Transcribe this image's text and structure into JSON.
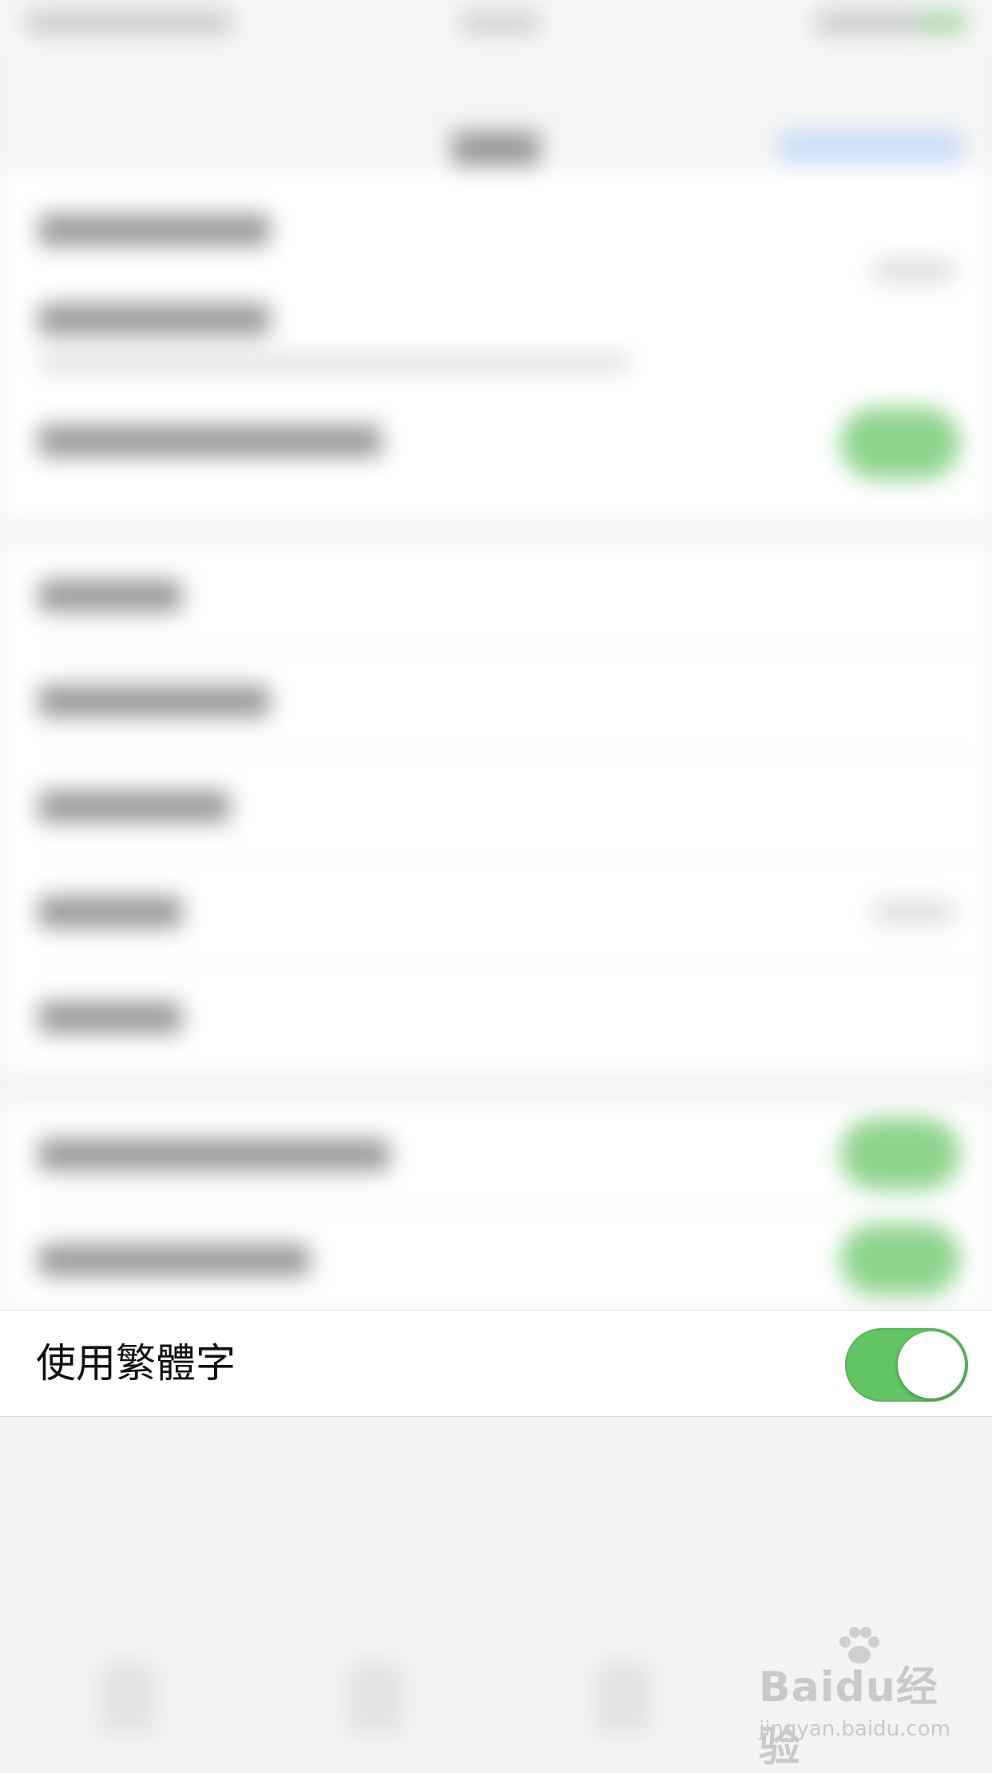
{
  "focused_setting": {
    "label": "使用繁體字",
    "toggle_on": true,
    "toggle_color": "#63c463"
  },
  "watermark": {
    "logo_text": "Baidu经验",
    "url": "jingyan.baidu.com"
  }
}
